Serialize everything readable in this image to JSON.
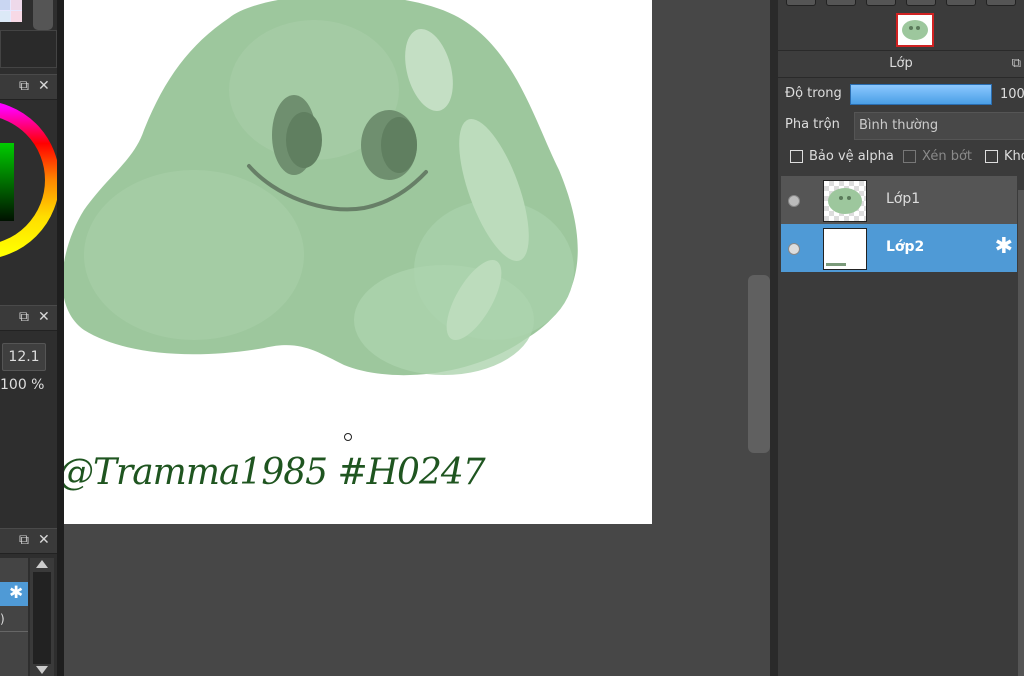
{
  "left_panels": {
    "panel_size_value": "12.1",
    "panel_opacity_value": "100 %",
    "popout_icon": "popout-icon",
    "close_icon": "close-icon"
  },
  "canvas": {
    "signature_text": "@Tramma1985 #H0247"
  },
  "layer_panel": {
    "title": "Lớp",
    "opacity_label": "Độ trong",
    "opacity_value": "100",
    "opacity_level": 1.0,
    "blend_label": "Pha trộn",
    "blend_value": "Bình thường",
    "protect_alpha_label": "Bảo vệ alpha",
    "clipping_label": "Xén bớt",
    "lock_label": "Khó",
    "layers": [
      {
        "name": "Lớp1",
        "selected": false
      },
      {
        "name": "Lớp2",
        "selected": true
      }
    ],
    "accent_color": "#4f9ad6",
    "selected_thumb_border": "#d02222"
  }
}
